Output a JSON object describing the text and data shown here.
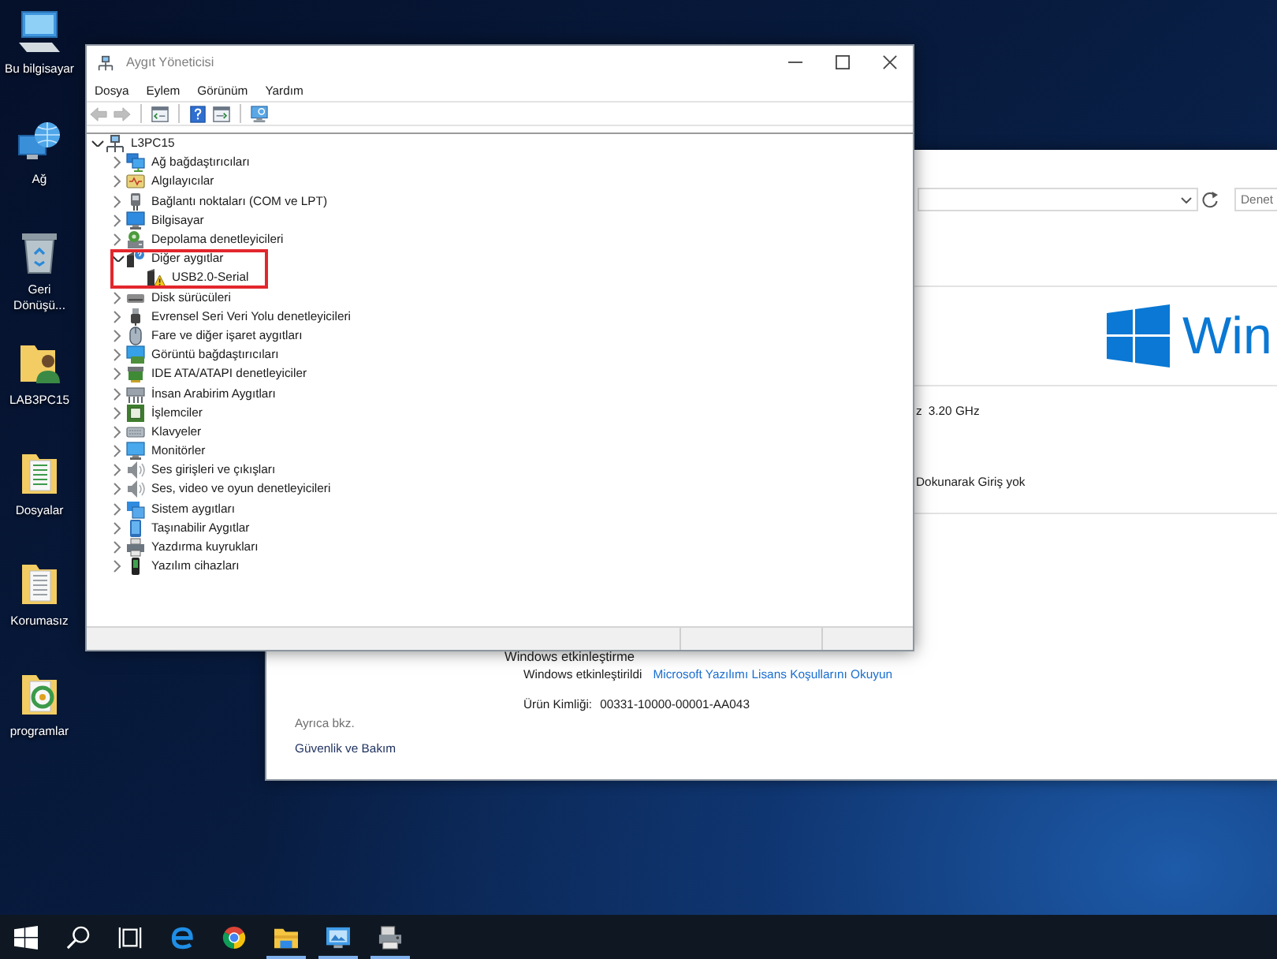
{
  "desktop_icons": [
    {
      "label": "Bu bilgisayar",
      "kind": "computer"
    },
    {
      "label": "Ağ",
      "kind": "network"
    },
    {
      "label": "Geri Dönüşü...",
      "kind": "recycle"
    },
    {
      "label": "LAB3PC15",
      "kind": "user-folder"
    },
    {
      "label": "Dosyalar",
      "kind": "sheet-folder"
    },
    {
      "label": "Korumasız",
      "kind": "doc-folder"
    },
    {
      "label": "programlar",
      "kind": "app-folder"
    }
  ],
  "system_window": {
    "search": {
      "placeholder": "Denet"
    },
    "logo_text": "Win",
    "processor": {
      "value_end": "z",
      "speed": "3.20 GHz"
    },
    "pen_touch": "Dokunarak Giriş yok",
    "activation": {
      "heading": "Windows etkinleştirme",
      "status": "Windows etkinleştirildi",
      "license_link": "Microsoft Yazılımı Lisans Koşullarını Okuyun",
      "product_id_label": "Ürün Kimliği:",
      "product_id": "00331-10000-00001-AA043"
    },
    "see_also": {
      "heading": "Ayrıca bkz.",
      "links": [
        "Güvenlik ve Bakım"
      ]
    }
  },
  "device_manager": {
    "title": "Aygıt Yöneticisi",
    "menu": [
      "Dosya",
      "Eylem",
      "Görünüm",
      "Yardım"
    ],
    "toolbar": [
      {
        "kind": "back",
        "disabled": true
      },
      {
        "kind": "forward",
        "disabled": true
      },
      {
        "kind": "separator"
      },
      {
        "kind": "properties",
        "disabled": false
      },
      {
        "kind": "separator"
      },
      {
        "kind": "help",
        "disabled": false
      },
      {
        "kind": "update",
        "disabled": false
      },
      {
        "kind": "separator"
      },
      {
        "kind": "scan",
        "disabled": false
      }
    ],
    "tree": [
      {
        "label": "L3PC15",
        "kind": "host",
        "expanded": true,
        "children": [
          {
            "label": "Ağ bağdaştırıcıları",
            "kind": "network",
            "expanded": false,
            "highlighted": false
          },
          {
            "label": "Algılayıcılar",
            "kind": "sensor",
            "expanded": false,
            "highlighted": false
          },
          {
            "label": "Bağlantı noktaları (COM ve LPT)",
            "kind": "port",
            "expanded": false,
            "highlighted": false
          },
          {
            "label": "Bilgisayar",
            "kind": "computer",
            "expanded": false,
            "highlighted": false
          },
          {
            "label": "Depolama denetleyicileri",
            "kind": "storage",
            "expanded": false,
            "highlighted": false
          },
          {
            "label": "Diğer aygıtlar",
            "kind": "other",
            "expanded": true,
            "highlighted": true,
            "children": [
              {
                "label": "USB2.0-Serial",
                "kind": "unknown-warning"
              }
            ]
          },
          {
            "label": "Disk sürücüleri",
            "kind": "disk",
            "expanded": false,
            "highlighted": false
          },
          {
            "label": "Evrensel Seri Veri Yolu denetleyicileri",
            "kind": "usb",
            "expanded": false,
            "highlighted": false
          },
          {
            "label": "Fare ve diğer işaret aygıtları",
            "kind": "mouse",
            "expanded": false,
            "highlighted": false
          },
          {
            "label": "Görüntü bağdaştırıcıları",
            "kind": "display",
            "expanded": false,
            "highlighted": false
          },
          {
            "label": "IDE ATA/ATAPI denetleyiciler",
            "kind": "ide",
            "expanded": false,
            "highlighted": false
          },
          {
            "label": "İnsan Arabirim Aygıtları",
            "kind": "hid",
            "expanded": false,
            "highlighted": false
          },
          {
            "label": "İşlemciler",
            "kind": "cpu",
            "expanded": false,
            "highlighted": false
          },
          {
            "label": "Klavyeler",
            "kind": "keyboard",
            "expanded": false,
            "highlighted": false
          },
          {
            "label": "Monitörler",
            "kind": "monitor",
            "expanded": false,
            "highlighted": false
          },
          {
            "label": "Ses girişleri ve çıkışları",
            "kind": "audio",
            "expanded": false,
            "highlighted": false
          },
          {
            "label": "Ses, video ve oyun denetleyicileri",
            "kind": "sound",
            "expanded": false,
            "highlighted": false
          },
          {
            "label": "Sistem aygıtları",
            "kind": "system",
            "expanded": false,
            "highlighted": false
          },
          {
            "label": "Taşınabilir Aygıtlar",
            "kind": "portable",
            "expanded": false,
            "highlighted": false
          },
          {
            "label": "Yazdırma kuyrukları",
            "kind": "print",
            "expanded": false,
            "highlighted": false
          },
          {
            "label": "Yazılım cihazları",
            "kind": "software",
            "expanded": false,
            "highlighted": false
          }
        ]
      }
    ]
  },
  "taskbar": [
    {
      "kind": "start",
      "running": false
    },
    {
      "kind": "search",
      "running": false
    },
    {
      "kind": "task-view",
      "running": false
    },
    {
      "kind": "browser-e",
      "running": false
    },
    {
      "kind": "browser-ring",
      "running": false
    },
    {
      "kind": "explorer",
      "running": true
    },
    {
      "kind": "system",
      "running": true
    },
    {
      "kind": "device-manager",
      "running": true
    }
  ]
}
